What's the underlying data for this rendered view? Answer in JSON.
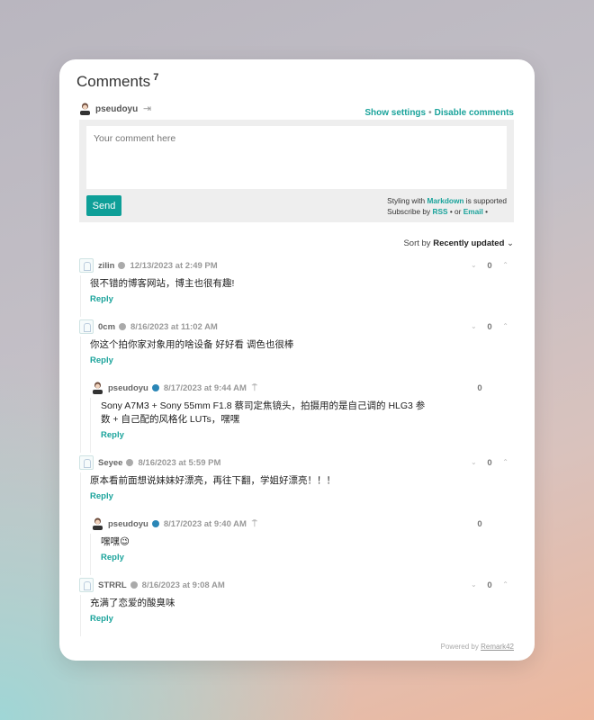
{
  "title": "Comments",
  "count": "7",
  "user": {
    "name": "pseudoyu"
  },
  "settings": {
    "show": "Show settings",
    "sep": "•",
    "disable": "Disable comments"
  },
  "form": {
    "placeholder": "Your comment here",
    "send": "Send",
    "styling_pre": "Styling with ",
    "markdown": "Markdown",
    "styling_post": " is supported",
    "subscribe_pre": "Subscribe by ",
    "rss": "RSS",
    "or": " • or ",
    "email": "Email",
    "email_post": " •"
  },
  "sort": {
    "label": "Sort by",
    "value": "Recently updated"
  },
  "reply_label": "Reply",
  "comments": [
    {
      "name": "zilin",
      "time": "12/13/2023 at 2:49 PM",
      "score": "0",
      "text": "很不错的博客网站，博主也很有趣!"
    },
    {
      "name": "0cm",
      "time": "8/16/2023 at 11:02 AM",
      "score": "0",
      "text": "你这个拍你家对象用的啥设备 好好看 调色也很棒",
      "reply": {
        "name": "pseudoyu",
        "time": "8/17/2023 at 9:44 AM",
        "score": "0",
        "text": "Sony A7M3 + Sony 55mm F1.8 蔡司定焦镜头，拍摄用的是自己调的 HLG3 参数 + 自己配的风格化 LUTs，嘿嘿"
      }
    },
    {
      "name": "Seyee",
      "time": "8/16/2023 at 5:59 PM",
      "score": "0",
      "text": "原本看前面想说妹妹好漂亮，再往下翻，学姐好漂亮！！！",
      "reply": {
        "name": "pseudoyu",
        "time": "8/17/2023 at 9:40 AM",
        "score": "0",
        "text": "嘿嘿😉"
      }
    },
    {
      "name": "STRRL",
      "time": "8/16/2023 at 9:08 AM",
      "score": "0",
      "text": "充满了恋爱的酸臭味"
    }
  ],
  "footer": {
    "powered": "Powered by ",
    "brand": "Remark42"
  }
}
